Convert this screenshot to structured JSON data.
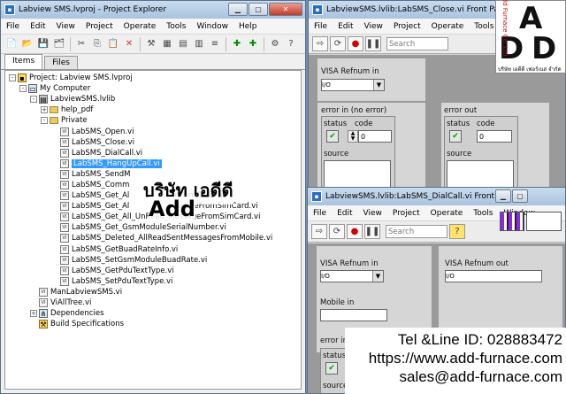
{
  "project_explorer": {
    "title": "Labview SMS.lvproj - Project Explorer",
    "menu": [
      "File",
      "Edit",
      "View",
      "Project",
      "Operate",
      "Tools",
      "Window",
      "Help"
    ],
    "tabs": [
      "Items",
      "Files"
    ],
    "tree": [
      {
        "label": "Project: Labview SMS.lvproj",
        "indent": 0,
        "icon": "project-icon",
        "exp": "-"
      },
      {
        "label": "My Computer",
        "indent": 1,
        "icon": "computer-icon",
        "exp": "-"
      },
      {
        "label": "LabviewSMS.lvlib",
        "indent": 2,
        "icon": "library-icon",
        "exp": "-"
      },
      {
        "label": "help_pdf",
        "indent": 3,
        "icon": "folder-icon",
        "exp": "+"
      },
      {
        "label": "Private",
        "indent": 3,
        "icon": "folder-icon",
        "exp": "-"
      },
      {
        "label": "LabSMS_Open.vi",
        "indent": 4,
        "icon": "vi-icon"
      },
      {
        "label": "LabSMS_Close.vi",
        "indent": 4,
        "icon": "vi-icon"
      },
      {
        "label": "LabSMS_DialCall.vi",
        "indent": 4,
        "icon": "vi-icon"
      },
      {
        "label": "LabSMS_HangUpCall.vi",
        "indent": 4,
        "icon": "vi-icon",
        "selected": true
      },
      {
        "label": "LabSMS_SendM",
        "indent": 4,
        "icon": "vi-icon"
      },
      {
        "label": "LabSMS_Comm",
        "indent": 4,
        "icon": "vi-icon"
      },
      {
        "label": "LabSMS_Get_Al",
        "tail": "omSimCard.vi",
        "indent": 4,
        "icon": "vi-icon"
      },
      {
        "label": "LabSMS_Get_Al",
        "tail": "lessageFromSimCard.vi",
        "indent": 4,
        "icon": "vi-icon"
      },
      {
        "label": "LabSMS_Get_All_UnRead_MessageFromSimCard.vi",
        "indent": 4,
        "icon": "vi-icon"
      },
      {
        "label": "LabSMS_Get_GsmModuleSerialNumber.vi",
        "indent": 4,
        "icon": "vi-icon"
      },
      {
        "label": "LabSMS_Deleted_AllReadSentMessagesFromMobile.vi",
        "indent": 4,
        "icon": "vi-icon"
      },
      {
        "label": "LabSMS_GetBuadRateInfo.vi",
        "indent": 4,
        "icon": "vi-icon"
      },
      {
        "label": "LabSMS_SetGsmModuleBuadRate.vi",
        "indent": 4,
        "icon": "vi-icon"
      },
      {
        "label": "LabSMS_GetPduTextType.vi",
        "indent": 4,
        "icon": "vi-icon"
      },
      {
        "label": "LabSMS_SetPduTextType.vi",
        "indent": 4,
        "icon": "vi-icon"
      },
      {
        "label": "ManLabviewSMS.vi",
        "indent": 2,
        "icon": "vi-icon"
      },
      {
        "label": "ViAllTree.vi",
        "indent": 2,
        "icon": "vi-icon"
      },
      {
        "label": "Dependencies",
        "indent": 2,
        "icon": "dependencies-icon",
        "exp": "+"
      },
      {
        "label": "Build Specifications",
        "indent": 2,
        "icon": "build-icon"
      }
    ]
  },
  "close_panel": {
    "title": "LabviewSMS.lvlib:LabSMS_Close.vi Front Panel ...",
    "menu": [
      "File",
      "Edit",
      "View",
      "Project",
      "Operate",
      "Tools"
    ],
    "search_placeholder": "Search",
    "visa_label": "VISA Refnum in",
    "visa_prefix": "I/O",
    "error_in_label": "error in (no error)",
    "error_out_label": "error out",
    "status_label": "status",
    "code_label": "code",
    "code_value": "0",
    "source_label": "source"
  },
  "dial_panel": {
    "title": "LabviewSMS.lvlib:LabSMS_DialCall.vi Front Pa...",
    "menu": [
      "File",
      "Edit",
      "View",
      "Project",
      "Operate",
      "Tools",
      "Window"
    ],
    "search_placeholder": "Search",
    "visa_in_label": "VISA Refnum in",
    "visa_out_label": "VISA Refnum out",
    "mobile_label": "Mobile in",
    "error_label": "error in",
    "status_label": "status",
    "source_label": "source",
    "visa_prefix": "I/O"
  },
  "overlay": {
    "thai_name": "บริษัท เอดีดี",
    "add_text": "Add",
    "logo_letters": [
      "A",
      "D",
      "D"
    ],
    "logo_vertical": "Add Furnace Co.,Ltd.",
    "logo_thai": "บริษัท เอดีดี เฟอร์เนส จำกัด",
    "contact": [
      "Tel &Line ID: 028883472",
      "https://www.add-furnace.com",
      "sales@add-furnace.com"
    ]
  }
}
